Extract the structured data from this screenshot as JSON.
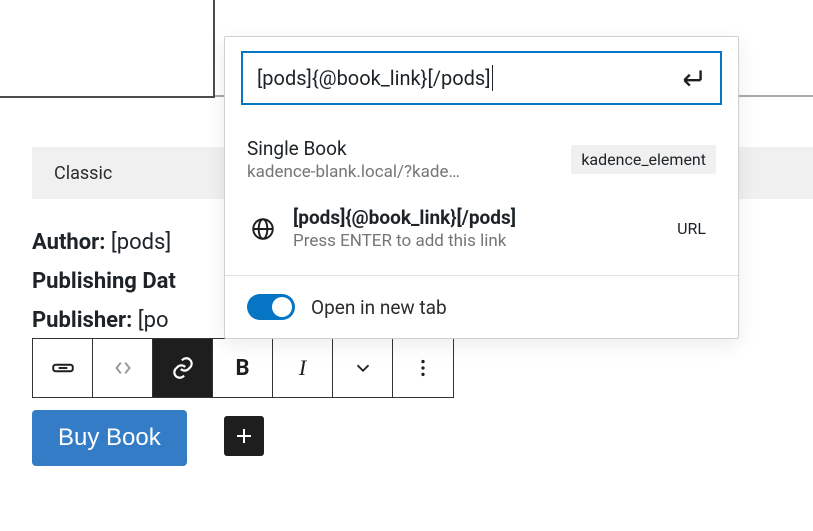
{
  "classic_label": "Classic",
  "content": {
    "author_label": "Author",
    "author_value": "[pods]",
    "pubdate_label": "Publishing Dat",
    "publisher_label": "Publisher",
    "publisher_value": "[po"
  },
  "button": {
    "buy_label": "Buy Book"
  },
  "link_popover": {
    "input_value": "[pods]{@book_link}[/pods]",
    "results": [
      {
        "title": "Single Book",
        "subtitle": "kadence-blank.local/?kade…",
        "tag": "kadence_element"
      },
      {
        "title": "[pods]{@book_link}[/pods]",
        "subtitle": "Press ENTER to add this link",
        "tag": "URL",
        "icon": "globe"
      }
    ],
    "open_new_tab_label": "Open in new tab",
    "open_new_tab": true
  }
}
